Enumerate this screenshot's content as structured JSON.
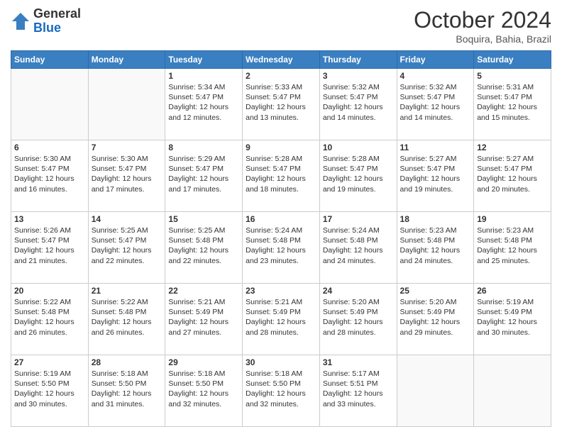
{
  "header": {
    "logo_general": "General",
    "logo_blue": "Blue",
    "month_title": "October 2024",
    "location": "Boquira, Bahia, Brazil"
  },
  "days_of_week": [
    "Sunday",
    "Monday",
    "Tuesday",
    "Wednesday",
    "Thursday",
    "Friday",
    "Saturday"
  ],
  "weeks": [
    [
      {
        "day": "",
        "sunrise": "",
        "sunset": "",
        "daylight": ""
      },
      {
        "day": "",
        "sunrise": "",
        "sunset": "",
        "daylight": ""
      },
      {
        "day": "1",
        "sunrise": "Sunrise: 5:34 AM",
        "sunset": "Sunset: 5:47 PM",
        "daylight": "Daylight: 12 hours and 12 minutes."
      },
      {
        "day": "2",
        "sunrise": "Sunrise: 5:33 AM",
        "sunset": "Sunset: 5:47 PM",
        "daylight": "Daylight: 12 hours and 13 minutes."
      },
      {
        "day": "3",
        "sunrise": "Sunrise: 5:32 AM",
        "sunset": "Sunset: 5:47 PM",
        "daylight": "Daylight: 12 hours and 14 minutes."
      },
      {
        "day": "4",
        "sunrise": "Sunrise: 5:32 AM",
        "sunset": "Sunset: 5:47 PM",
        "daylight": "Daylight: 12 hours and 14 minutes."
      },
      {
        "day": "5",
        "sunrise": "Sunrise: 5:31 AM",
        "sunset": "Sunset: 5:47 PM",
        "daylight": "Daylight: 12 hours and 15 minutes."
      }
    ],
    [
      {
        "day": "6",
        "sunrise": "Sunrise: 5:30 AM",
        "sunset": "Sunset: 5:47 PM",
        "daylight": "Daylight: 12 hours and 16 minutes."
      },
      {
        "day": "7",
        "sunrise": "Sunrise: 5:30 AM",
        "sunset": "Sunset: 5:47 PM",
        "daylight": "Daylight: 12 hours and 17 minutes."
      },
      {
        "day": "8",
        "sunrise": "Sunrise: 5:29 AM",
        "sunset": "Sunset: 5:47 PM",
        "daylight": "Daylight: 12 hours and 17 minutes."
      },
      {
        "day": "9",
        "sunrise": "Sunrise: 5:28 AM",
        "sunset": "Sunset: 5:47 PM",
        "daylight": "Daylight: 12 hours and 18 minutes."
      },
      {
        "day": "10",
        "sunrise": "Sunrise: 5:28 AM",
        "sunset": "Sunset: 5:47 PM",
        "daylight": "Daylight: 12 hours and 19 minutes."
      },
      {
        "day": "11",
        "sunrise": "Sunrise: 5:27 AM",
        "sunset": "Sunset: 5:47 PM",
        "daylight": "Daylight: 12 hours and 19 minutes."
      },
      {
        "day": "12",
        "sunrise": "Sunrise: 5:27 AM",
        "sunset": "Sunset: 5:47 PM",
        "daylight": "Daylight: 12 hours and 20 minutes."
      }
    ],
    [
      {
        "day": "13",
        "sunrise": "Sunrise: 5:26 AM",
        "sunset": "Sunset: 5:47 PM",
        "daylight": "Daylight: 12 hours and 21 minutes."
      },
      {
        "day": "14",
        "sunrise": "Sunrise: 5:25 AM",
        "sunset": "Sunset: 5:47 PM",
        "daylight": "Daylight: 12 hours and 22 minutes."
      },
      {
        "day": "15",
        "sunrise": "Sunrise: 5:25 AM",
        "sunset": "Sunset: 5:48 PM",
        "daylight": "Daylight: 12 hours and 22 minutes."
      },
      {
        "day": "16",
        "sunrise": "Sunrise: 5:24 AM",
        "sunset": "Sunset: 5:48 PM",
        "daylight": "Daylight: 12 hours and 23 minutes."
      },
      {
        "day": "17",
        "sunrise": "Sunrise: 5:24 AM",
        "sunset": "Sunset: 5:48 PM",
        "daylight": "Daylight: 12 hours and 24 minutes."
      },
      {
        "day": "18",
        "sunrise": "Sunrise: 5:23 AM",
        "sunset": "Sunset: 5:48 PM",
        "daylight": "Daylight: 12 hours and 24 minutes."
      },
      {
        "day": "19",
        "sunrise": "Sunrise: 5:23 AM",
        "sunset": "Sunset: 5:48 PM",
        "daylight": "Daylight: 12 hours and 25 minutes."
      }
    ],
    [
      {
        "day": "20",
        "sunrise": "Sunrise: 5:22 AM",
        "sunset": "Sunset: 5:48 PM",
        "daylight": "Daylight: 12 hours and 26 minutes."
      },
      {
        "day": "21",
        "sunrise": "Sunrise: 5:22 AM",
        "sunset": "Sunset: 5:48 PM",
        "daylight": "Daylight: 12 hours and 26 minutes."
      },
      {
        "day": "22",
        "sunrise": "Sunrise: 5:21 AM",
        "sunset": "Sunset: 5:49 PM",
        "daylight": "Daylight: 12 hours and 27 minutes."
      },
      {
        "day": "23",
        "sunrise": "Sunrise: 5:21 AM",
        "sunset": "Sunset: 5:49 PM",
        "daylight": "Daylight: 12 hours and 28 minutes."
      },
      {
        "day": "24",
        "sunrise": "Sunrise: 5:20 AM",
        "sunset": "Sunset: 5:49 PM",
        "daylight": "Daylight: 12 hours and 28 minutes."
      },
      {
        "day": "25",
        "sunrise": "Sunrise: 5:20 AM",
        "sunset": "Sunset: 5:49 PM",
        "daylight": "Daylight: 12 hours and 29 minutes."
      },
      {
        "day": "26",
        "sunrise": "Sunrise: 5:19 AM",
        "sunset": "Sunset: 5:49 PM",
        "daylight": "Daylight: 12 hours and 30 minutes."
      }
    ],
    [
      {
        "day": "27",
        "sunrise": "Sunrise: 5:19 AM",
        "sunset": "Sunset: 5:50 PM",
        "daylight": "Daylight: 12 hours and 30 minutes."
      },
      {
        "day": "28",
        "sunrise": "Sunrise: 5:18 AM",
        "sunset": "Sunset: 5:50 PM",
        "daylight": "Daylight: 12 hours and 31 minutes."
      },
      {
        "day": "29",
        "sunrise": "Sunrise: 5:18 AM",
        "sunset": "Sunset: 5:50 PM",
        "daylight": "Daylight: 12 hours and 32 minutes."
      },
      {
        "day": "30",
        "sunrise": "Sunrise: 5:18 AM",
        "sunset": "Sunset: 5:50 PM",
        "daylight": "Daylight: 12 hours and 32 minutes."
      },
      {
        "day": "31",
        "sunrise": "Sunrise: 5:17 AM",
        "sunset": "Sunset: 5:51 PM",
        "daylight": "Daylight: 12 hours and 33 minutes."
      },
      {
        "day": "",
        "sunrise": "",
        "sunset": "",
        "daylight": ""
      },
      {
        "day": "",
        "sunrise": "",
        "sunset": "",
        "daylight": ""
      }
    ]
  ]
}
